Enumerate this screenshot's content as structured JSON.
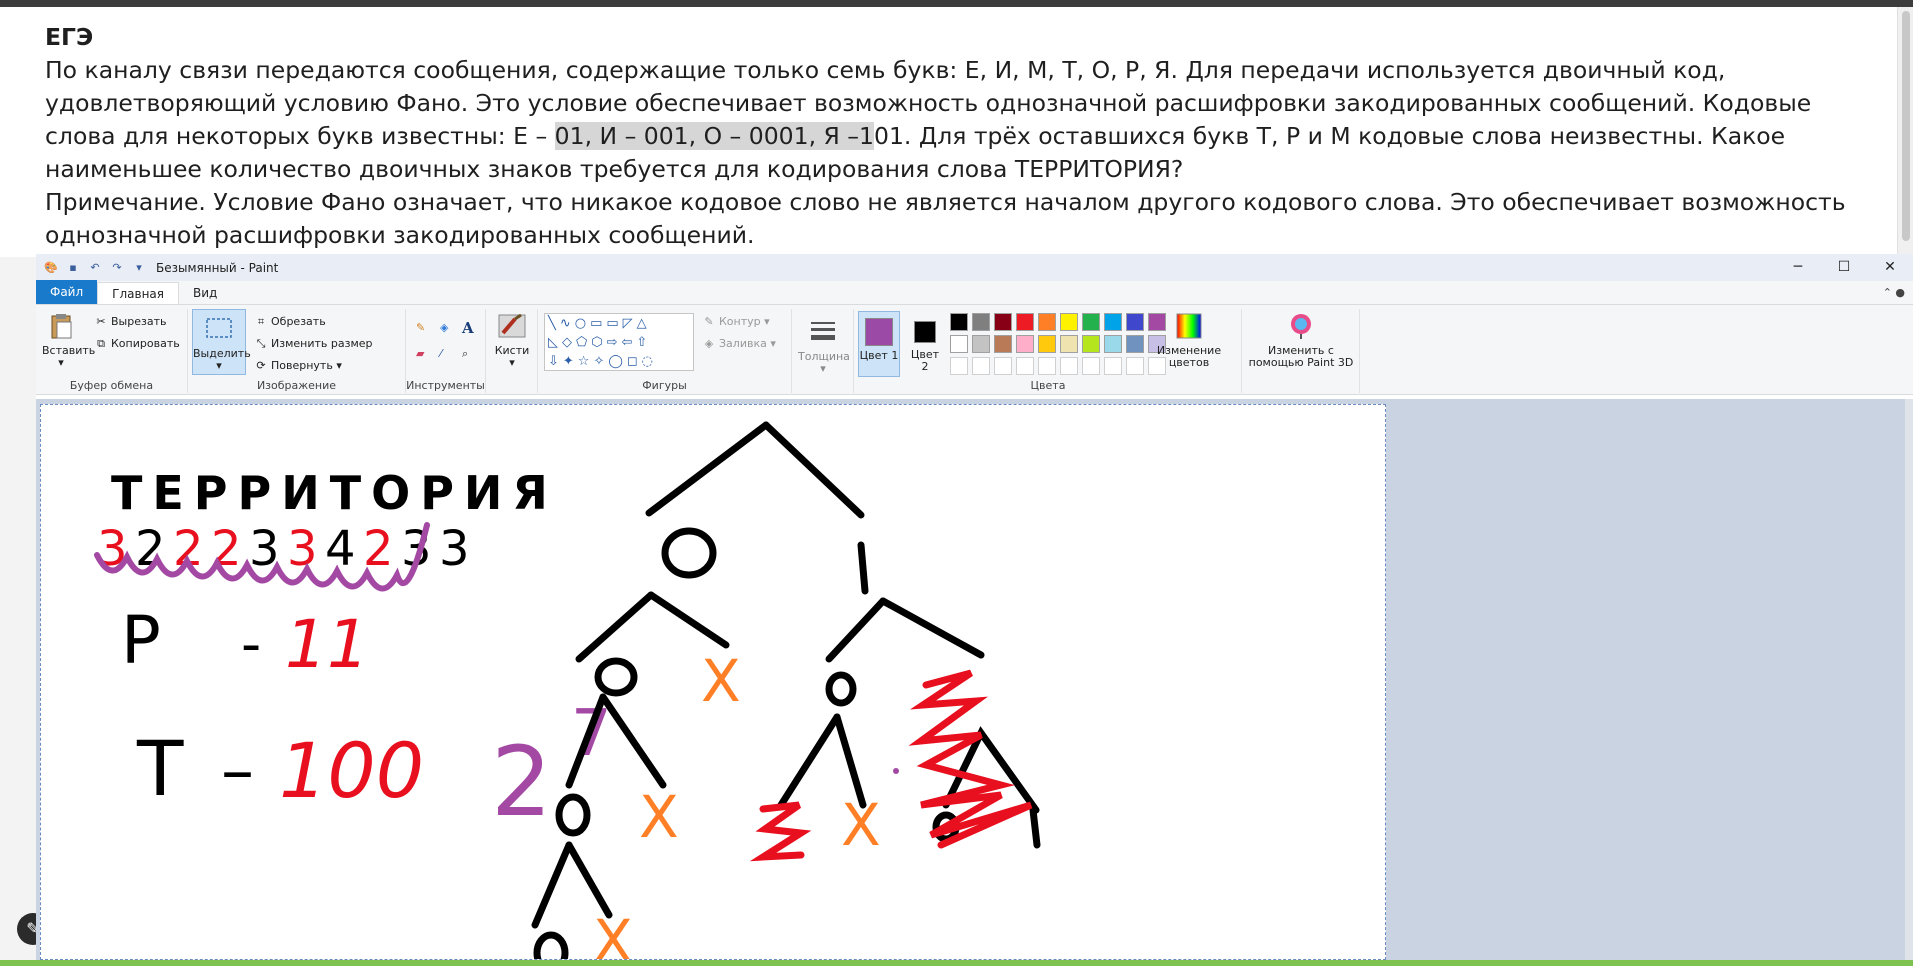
{
  "document": {
    "title": "ЕГЭ",
    "p1_a": "По каналу связи передаются сообщения, содержащие только семь букв: Е, И, М, Т, О, Р, Я. Для передачи используется двоичный код, удовлетворяющий условию Фано. Это условие обеспечивает возможность однозначной расшифровки закодированных сообщений. Кодовые слова для некоторых букв известны: Е – ",
    "p1_hl": "01, И – 001, О – 0001, Я –1",
    "p1_b": "01. Для трёх оставшихся букв Т, Р и М кодовые слова неизвестны. Какое наименьшее количество двоичных знаков требуется для кодирования слова ТЕРРИТОРИЯ?",
    "p2": "Примечание. Условие Фано означает, что никакое кодовое слово не является началом другого кодового слова. Это обеспечивает возможность однозначной расшифровки закодированных сообщений."
  },
  "paint": {
    "window_title": "Безымянный - Paint",
    "tabs": [
      "Файл",
      "Главная",
      "Вид"
    ],
    "clipboard": {
      "paste": "Вставить",
      "cut": "Вырезать",
      "copy": "Копировать",
      "label": "Буфер обмена"
    },
    "image": {
      "select": "Выделить",
      "crop": "Обрезать",
      "resize": "Изменить размер",
      "rotate": "Повернуть",
      "label": "Изображение"
    },
    "tools": {
      "label": "Инструменты"
    },
    "brushes": {
      "label": "Кисти"
    },
    "shapes": {
      "outline": "Контур",
      "fill": "Заливка",
      "label": "Фигуры"
    },
    "size": {
      "label": "Толщина"
    },
    "colors": {
      "color1": "Цвет 1",
      "color2": "Цвет 2",
      "edit": "Изменение цветов",
      "paint3d": "Изменить с помощью Paint 3D",
      "label": "Цвета",
      "color1_value": "#9b4aa6",
      "color2_value": "#000000",
      "palette_row1": [
        "#000000",
        "#7f7f7f",
        "#880015",
        "#ed1c24",
        "#ff7f27",
        "#fff200",
        "#22b14c",
        "#00a2e8",
        "#3f48cc",
        "#a349a4"
      ],
      "palette_row2": [
        "#ffffff",
        "#c3c3c3",
        "#b97a57",
        "#ffaec9",
        "#ffc90e",
        "#efe4b0",
        "#b5e61d",
        "#99d9ea",
        "#7092be",
        "#c8bfe7"
      ]
    }
  },
  "drawing": {
    "word": "ТЕРРИТОРИЯ",
    "counts": [
      "3",
      "2",
      "2",
      "2",
      "3",
      "3",
      "4",
      "2",
      "3",
      "3"
    ],
    "r_label": "Р",
    "r_dash": "-",
    "r_code": "11",
    "t_label": "Т",
    "t_dash": "–",
    "t_code": "100",
    "power": "2",
    "power_exp": "7",
    "tree_zero": "0",
    "tree_one": "1",
    "cross": "X"
  }
}
